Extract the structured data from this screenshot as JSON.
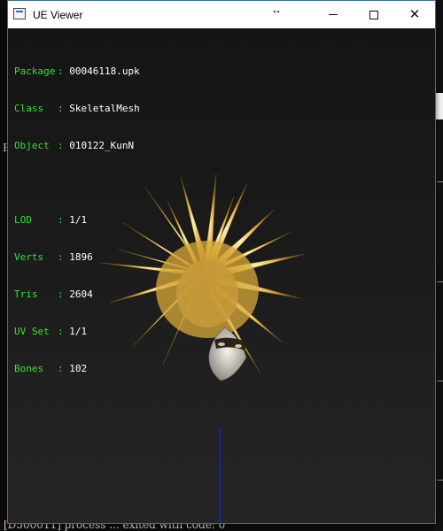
{
  "window": {
    "title": "UE Viewer",
    "buttons": {
      "minimize": "minimize-icon",
      "maximize": "maximize-icon",
      "close": "close-icon"
    }
  },
  "info": {
    "package_label": "Package",
    "package_value": "00046118.upk",
    "class_label": "Class",
    "class_value": "SkeletalMesh",
    "object_label": "Object",
    "object_value": "010122_KunN",
    "lod_label": "LOD",
    "lod_value": "1/1",
    "verts_label": "Verts",
    "verts_value": "1896",
    "tris_label": "Tris",
    "tris_value": "2604",
    "uvset_label": "UV Set",
    "uvset_value": "1/1",
    "bones_label": "Bones",
    "bones_value": "102"
  },
  "background": {
    "console_bottom": "[D500011] process  ...  exited with code: 0",
    "left_char": "E"
  },
  "colors": {
    "label": "#35e135",
    "value": "#ffffff",
    "axis": "#1a2ad0"
  }
}
